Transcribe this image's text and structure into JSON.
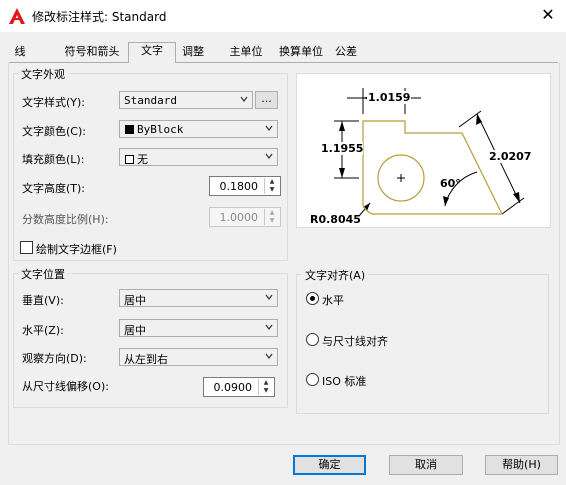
{
  "window": {
    "title": "修改标注样式: Standard",
    "close_glyph": "✕"
  },
  "tabs": [
    {
      "label": "线"
    },
    {
      "label": "符号和箭头"
    },
    {
      "label": "文字",
      "active": true
    },
    {
      "label": "调整"
    },
    {
      "label": "主单位"
    },
    {
      "label": "换算单位"
    },
    {
      "label": "公差"
    }
  ],
  "appearance": {
    "group_title": "文字外观",
    "text_style": {
      "label": "文字样式(Y):",
      "value": "Standard",
      "browse_label": "..."
    },
    "text_color": {
      "label": "文字颜色(C):",
      "value": "ByBlock",
      "swatch_color": "#000000"
    },
    "fill_color": {
      "label": "填充颜色(L):",
      "value": "无",
      "swatch_color": "#ffffff"
    },
    "text_height": {
      "label": "文字高度(T):",
      "value": "0.1800"
    },
    "fraction_scale": {
      "label": "分数高度比例(H):",
      "value": "1.0000",
      "disabled": true
    },
    "draw_frame": {
      "label": "绘制文字边框(F)",
      "checked": false
    }
  },
  "placement": {
    "group_title": "文字位置",
    "vertical": {
      "label": "垂直(V):",
      "value": "居中"
    },
    "horizontal": {
      "label": "水平(Z):",
      "value": "居中"
    },
    "view_direction": {
      "label": "观察方向(D):",
      "value": "从左到右"
    },
    "offset": {
      "label": "从尺寸线偏移(O):",
      "value": "0.0900"
    }
  },
  "alignment": {
    "group_title": "文字对齐(A)",
    "options": [
      {
        "label": "水平",
        "selected": true
      },
      {
        "label": "与尺寸线对齐",
        "selected": false
      },
      {
        "label": "ISO 标准",
        "selected": false
      }
    ]
  },
  "preview": {
    "dim_top": "1.0159",
    "dim_left": "1.1955",
    "dim_right": "2.0207",
    "dim_angle": "60°",
    "dim_radius": "R0.8045",
    "outline_color": "#b89c3a"
  },
  "buttons": {
    "ok": "确定",
    "cancel": "取消",
    "help": "帮助(H)"
  }
}
